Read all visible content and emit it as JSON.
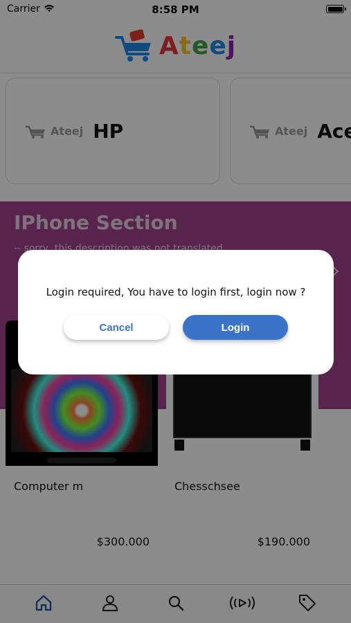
{
  "status_bar": {
    "carrier": "Carrier",
    "time": "8:58 PM"
  },
  "header": {
    "logo_text": "Ateej"
  },
  "brands": [
    {
      "logo_text": "Ateej",
      "name": "HP"
    },
    {
      "logo_text": "Ateej",
      "name": "Acer"
    }
  ],
  "section": {
    "title": "IPhone Section",
    "description": "-- sorry, this description was not translated",
    "color": "#a0408c"
  },
  "products": [
    {
      "name": "Computer m",
      "price": "$300.000"
    },
    {
      "name": "Chesschsee",
      "price": "$190.000"
    }
  ],
  "dialog": {
    "message": "Login required, You have to login first, login now ?",
    "cancel_label": "Cancel",
    "login_label": "Login",
    "accent": "#3a73c8"
  },
  "tabbar": {
    "items": [
      {
        "icon": "home-icon",
        "active": true
      },
      {
        "icon": "profile-icon",
        "active": false
      },
      {
        "icon": "search-icon",
        "active": false
      },
      {
        "icon": "live-icon",
        "active": false
      },
      {
        "icon": "tag-icon",
        "active": false
      }
    ]
  }
}
